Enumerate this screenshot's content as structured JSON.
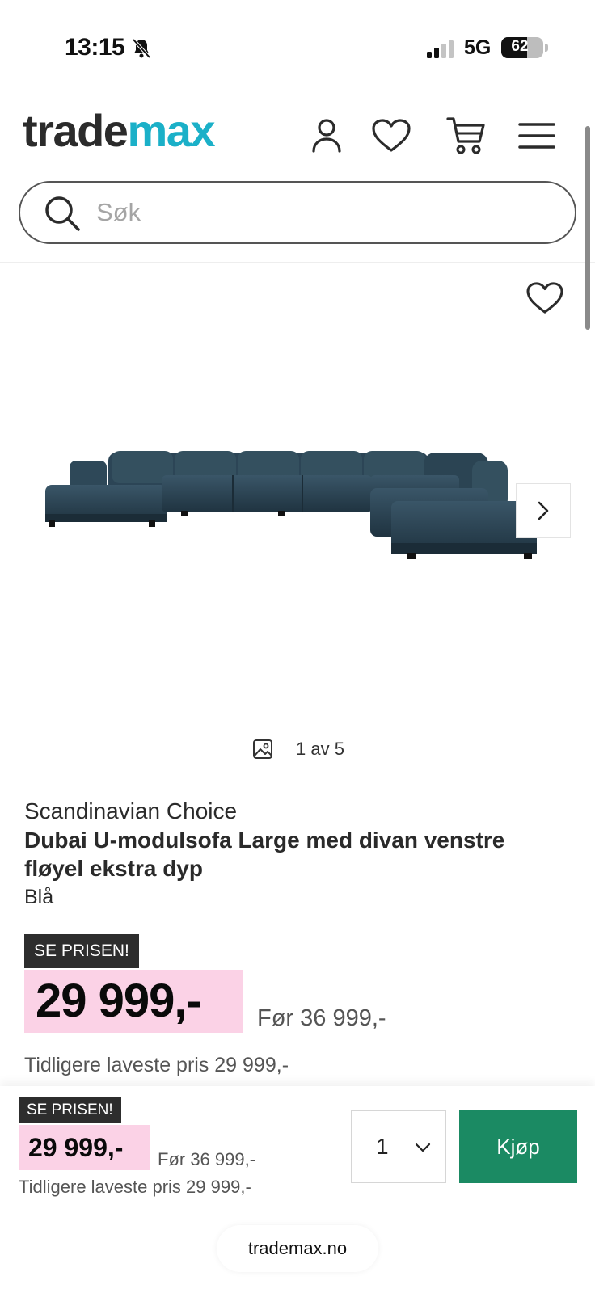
{
  "status_bar": {
    "time": "13:15",
    "network": "5G",
    "battery": "62",
    "battery_level": 0.62
  },
  "header": {
    "logo_part1": "trade",
    "logo_part2": "max",
    "icons": [
      "user-icon",
      "heart-icon",
      "cart-icon",
      "menu-icon"
    ]
  },
  "search": {
    "placeholder": "Søk"
  },
  "gallery": {
    "counter": "1 av 5"
  },
  "product": {
    "brand": "Scandinavian Choice",
    "title": "Dubai U-modulsofa Large med divan venstre fløyel ekstra dyp",
    "color": "Blå",
    "badge": "SE PRISEN!",
    "price": "29 999,-",
    "before_price": "Før 36 999,-",
    "lowest_price": "Tidligere laveste pris 29 999,-"
  },
  "buy_bar": {
    "badge": "SE PRISEN!",
    "price": "29 999,-",
    "before_price": "Før 36 999,-",
    "lowest_price": "Tidligere laveste pris 29 999,-",
    "quantity": "1",
    "buy_label": "Kjøp"
  },
  "browser": {
    "url": "trademax.no"
  },
  "colors": {
    "brand_teal": "#1bb0c8",
    "price_highlight": "#fbd2e6",
    "buy_button": "#1b8a63",
    "sofa_fabric": "#2c4556"
  }
}
